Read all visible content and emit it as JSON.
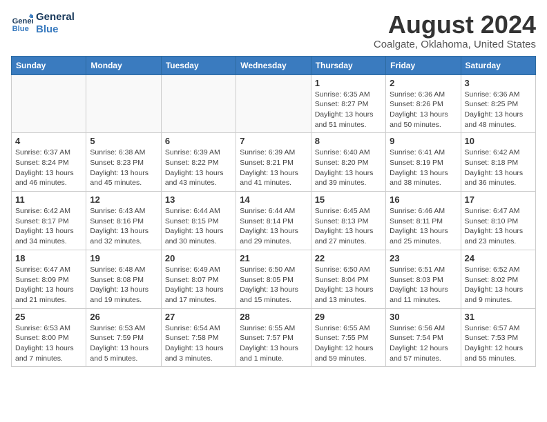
{
  "header": {
    "logo_line1": "General",
    "logo_line2": "Blue",
    "month_year": "August 2024",
    "location": "Coalgate, Oklahoma, United States"
  },
  "weekdays": [
    "Sunday",
    "Monday",
    "Tuesday",
    "Wednesday",
    "Thursday",
    "Friday",
    "Saturday"
  ],
  "weeks": [
    [
      {
        "day": "",
        "info": ""
      },
      {
        "day": "",
        "info": ""
      },
      {
        "day": "",
        "info": ""
      },
      {
        "day": "",
        "info": ""
      },
      {
        "day": "1",
        "info": "Sunrise: 6:35 AM\nSunset: 8:27 PM\nDaylight: 13 hours\nand 51 minutes."
      },
      {
        "day": "2",
        "info": "Sunrise: 6:36 AM\nSunset: 8:26 PM\nDaylight: 13 hours\nand 50 minutes."
      },
      {
        "day": "3",
        "info": "Sunrise: 6:36 AM\nSunset: 8:25 PM\nDaylight: 13 hours\nand 48 minutes."
      }
    ],
    [
      {
        "day": "4",
        "info": "Sunrise: 6:37 AM\nSunset: 8:24 PM\nDaylight: 13 hours\nand 46 minutes."
      },
      {
        "day": "5",
        "info": "Sunrise: 6:38 AM\nSunset: 8:23 PM\nDaylight: 13 hours\nand 45 minutes."
      },
      {
        "day": "6",
        "info": "Sunrise: 6:39 AM\nSunset: 8:22 PM\nDaylight: 13 hours\nand 43 minutes."
      },
      {
        "day": "7",
        "info": "Sunrise: 6:39 AM\nSunset: 8:21 PM\nDaylight: 13 hours\nand 41 minutes."
      },
      {
        "day": "8",
        "info": "Sunrise: 6:40 AM\nSunset: 8:20 PM\nDaylight: 13 hours\nand 39 minutes."
      },
      {
        "day": "9",
        "info": "Sunrise: 6:41 AM\nSunset: 8:19 PM\nDaylight: 13 hours\nand 38 minutes."
      },
      {
        "day": "10",
        "info": "Sunrise: 6:42 AM\nSunset: 8:18 PM\nDaylight: 13 hours\nand 36 minutes."
      }
    ],
    [
      {
        "day": "11",
        "info": "Sunrise: 6:42 AM\nSunset: 8:17 PM\nDaylight: 13 hours\nand 34 minutes."
      },
      {
        "day": "12",
        "info": "Sunrise: 6:43 AM\nSunset: 8:16 PM\nDaylight: 13 hours\nand 32 minutes."
      },
      {
        "day": "13",
        "info": "Sunrise: 6:44 AM\nSunset: 8:15 PM\nDaylight: 13 hours\nand 30 minutes."
      },
      {
        "day": "14",
        "info": "Sunrise: 6:44 AM\nSunset: 8:14 PM\nDaylight: 13 hours\nand 29 minutes."
      },
      {
        "day": "15",
        "info": "Sunrise: 6:45 AM\nSunset: 8:13 PM\nDaylight: 13 hours\nand 27 minutes."
      },
      {
        "day": "16",
        "info": "Sunrise: 6:46 AM\nSunset: 8:11 PM\nDaylight: 13 hours\nand 25 minutes."
      },
      {
        "day": "17",
        "info": "Sunrise: 6:47 AM\nSunset: 8:10 PM\nDaylight: 13 hours\nand 23 minutes."
      }
    ],
    [
      {
        "day": "18",
        "info": "Sunrise: 6:47 AM\nSunset: 8:09 PM\nDaylight: 13 hours\nand 21 minutes."
      },
      {
        "day": "19",
        "info": "Sunrise: 6:48 AM\nSunset: 8:08 PM\nDaylight: 13 hours\nand 19 minutes."
      },
      {
        "day": "20",
        "info": "Sunrise: 6:49 AM\nSunset: 8:07 PM\nDaylight: 13 hours\nand 17 minutes."
      },
      {
        "day": "21",
        "info": "Sunrise: 6:50 AM\nSunset: 8:05 PM\nDaylight: 13 hours\nand 15 minutes."
      },
      {
        "day": "22",
        "info": "Sunrise: 6:50 AM\nSunset: 8:04 PM\nDaylight: 13 hours\nand 13 minutes."
      },
      {
        "day": "23",
        "info": "Sunrise: 6:51 AM\nSunset: 8:03 PM\nDaylight: 13 hours\nand 11 minutes."
      },
      {
        "day": "24",
        "info": "Sunrise: 6:52 AM\nSunset: 8:02 PM\nDaylight: 13 hours\nand 9 minutes."
      }
    ],
    [
      {
        "day": "25",
        "info": "Sunrise: 6:53 AM\nSunset: 8:00 PM\nDaylight: 13 hours\nand 7 minutes."
      },
      {
        "day": "26",
        "info": "Sunrise: 6:53 AM\nSunset: 7:59 PM\nDaylight: 13 hours\nand 5 minutes."
      },
      {
        "day": "27",
        "info": "Sunrise: 6:54 AM\nSunset: 7:58 PM\nDaylight: 13 hours\nand 3 minutes."
      },
      {
        "day": "28",
        "info": "Sunrise: 6:55 AM\nSunset: 7:57 PM\nDaylight: 13 hours\nand 1 minute."
      },
      {
        "day": "29",
        "info": "Sunrise: 6:55 AM\nSunset: 7:55 PM\nDaylight: 12 hours\nand 59 minutes."
      },
      {
        "day": "30",
        "info": "Sunrise: 6:56 AM\nSunset: 7:54 PM\nDaylight: 12 hours\nand 57 minutes."
      },
      {
        "day": "31",
        "info": "Sunrise: 6:57 AM\nSunset: 7:53 PM\nDaylight: 12 hours\nand 55 minutes."
      }
    ]
  ]
}
